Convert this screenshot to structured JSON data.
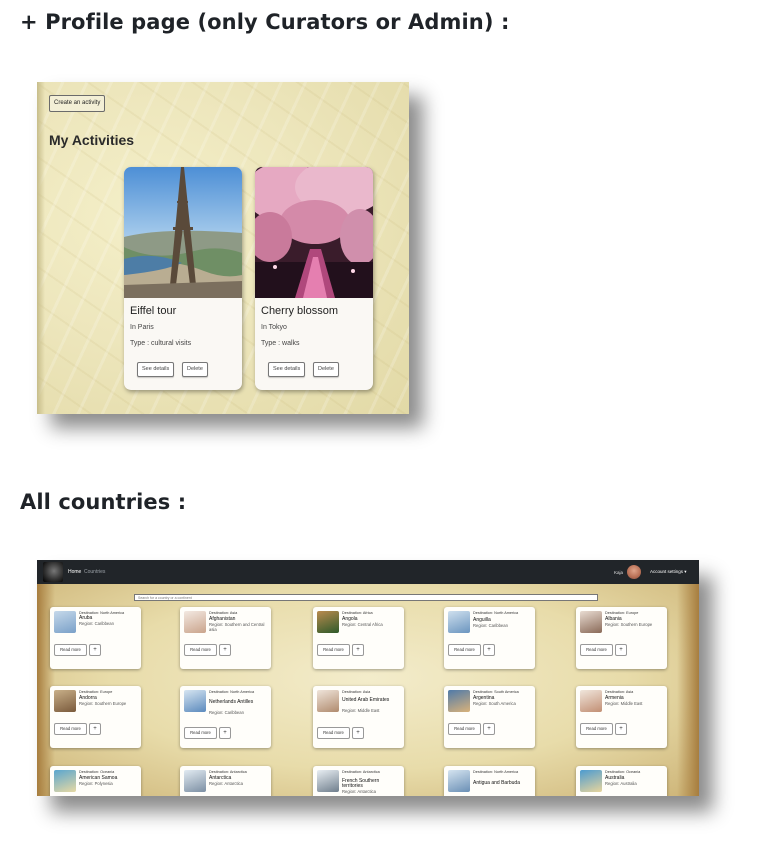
{
  "headings": {
    "profile": "+ Profile page (only Curators or Admin) :",
    "countries": "All countries :"
  },
  "profile_page": {
    "create_button": "Create an activity",
    "section_title": "My Activities",
    "cards": [
      {
        "title": "Eiffel tour",
        "location": "In Paris",
        "type": "Type : cultural visits",
        "details_button": "See details",
        "delete_button": "Delete",
        "image": "eiffel-tower-photo"
      },
      {
        "title": "Cherry blossom",
        "location": "In Tokyo",
        "type": "Type : walks",
        "details_button": "See details",
        "delete_button": "Delete",
        "image": "cherry-blossom-photo"
      }
    ]
  },
  "countries_page": {
    "nav": {
      "home": "Home",
      "countries": "Countries",
      "user": "Kaja",
      "account": "Account settings ▾"
    },
    "search_placeholder": "Search for a country or a continent",
    "read_more": "Read more",
    "plus": "+",
    "cards": [
      {
        "dest": "Destination: North America",
        "name": "Aruba",
        "region": "Region: Caribbean"
      },
      {
        "dest": "Destination: Asia",
        "name": "Afghanistan",
        "region": "Region: Southern and Central asia"
      },
      {
        "dest": "Destination: Africa",
        "name": "Angola",
        "region": "Region: Central Africa"
      },
      {
        "dest": "Destination: North America",
        "name": "Anguilla",
        "region": "Region: Caribbean"
      },
      {
        "dest": "Destination: Europe",
        "name": "Albania",
        "region": "Region: Southern Europe"
      },
      {
        "dest": "Destination: Europe",
        "name": "Andorra",
        "region": "Region: Southern Europe"
      },
      {
        "dest": "Destination: North America",
        "name": "Netherlands Antilles",
        "region": "Region: Caribbean"
      },
      {
        "dest": "Destination: Asia",
        "name": "United Arab Emirates",
        "region": "Region: Middle East"
      },
      {
        "dest": "Destination: South America",
        "name": "Argentina",
        "region": "Region: South America"
      },
      {
        "dest": "Destination: Asia",
        "name": "Armenia",
        "region": "Region: Middle East"
      },
      {
        "dest": "Destination: Oceania",
        "name": "American Samoa",
        "region": "Region: Polynesia"
      },
      {
        "dest": "Destination: Antarctica",
        "name": "Antarctica",
        "region": "Region: Antarctica"
      },
      {
        "dest": "Destination: Antarctica",
        "name": "French Southern territories",
        "region": "Region: Antarctica"
      },
      {
        "dest": "Destination: North America",
        "name": "Antigua and Barbuda",
        "region": ""
      },
      {
        "dest": "Destination: Oceania",
        "name": "Australia",
        "region": "Region: Australia"
      }
    ]
  }
}
